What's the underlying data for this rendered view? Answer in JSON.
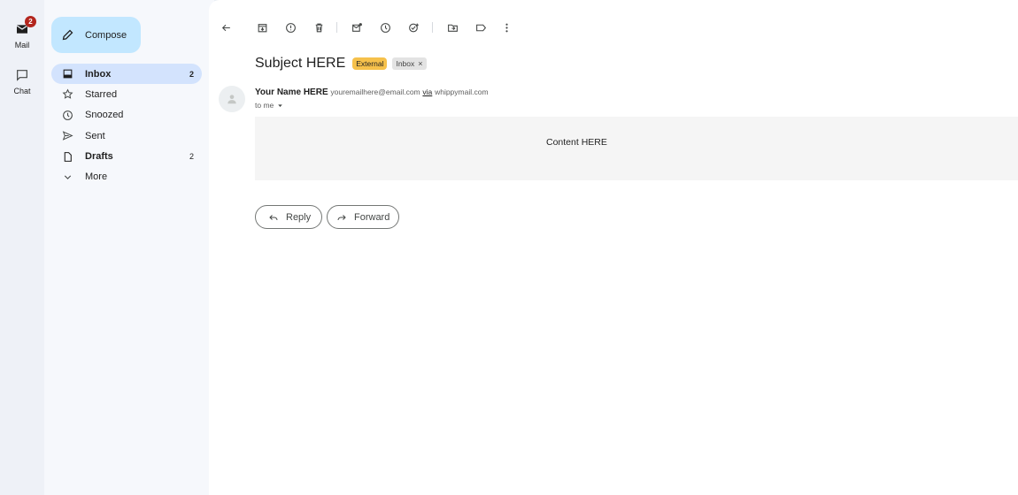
{
  "rail": {
    "mail": {
      "label": "Mail",
      "badge": "2",
      "icon": "mail-icon"
    },
    "chat": {
      "label": "Chat",
      "icon": "chat-icon"
    }
  },
  "compose": {
    "label": "Compose",
    "icon": "pencil-icon"
  },
  "nav": {
    "items": [
      {
        "label": "Inbox",
        "count": "2",
        "icon": "inbox-icon",
        "active": true
      },
      {
        "label": "Starred",
        "count": "",
        "icon": "star-icon"
      },
      {
        "label": "Snoozed",
        "count": "",
        "icon": "clock-icon"
      },
      {
        "label": "Sent",
        "count": "",
        "icon": "send-icon"
      },
      {
        "label": "Drafts",
        "count": "2",
        "icon": "draft-icon"
      },
      {
        "label": "More",
        "count": "",
        "icon": "chevron-down-icon"
      }
    ]
  },
  "toolbar": {
    "icons": [
      "back-arrow-icon",
      "archive-icon",
      "report-spam-icon",
      "delete-icon",
      "mark-unread-icon",
      "snooze-icon",
      "add-task-icon",
      "move-to-icon",
      "label-icon",
      "more-vert-icon"
    ]
  },
  "message": {
    "subject": "Subject HERE",
    "labels": {
      "external": "External",
      "inbox": "Inbox",
      "remove": "×"
    },
    "sender_name": "Your Name HERE",
    "sender_email": "youremailhere@email.com",
    "via": "via",
    "via_domain": "whippymail.com",
    "to": "to me",
    "content": "Content HERE"
  },
  "actions": {
    "reply": "Reply",
    "forward": "Forward"
  },
  "colors": {
    "accent_compose": "#c2e7ff",
    "active_nav": "#d3e3fd",
    "external_badge": "#f6c14b",
    "badge_red": "#b3261e"
  }
}
